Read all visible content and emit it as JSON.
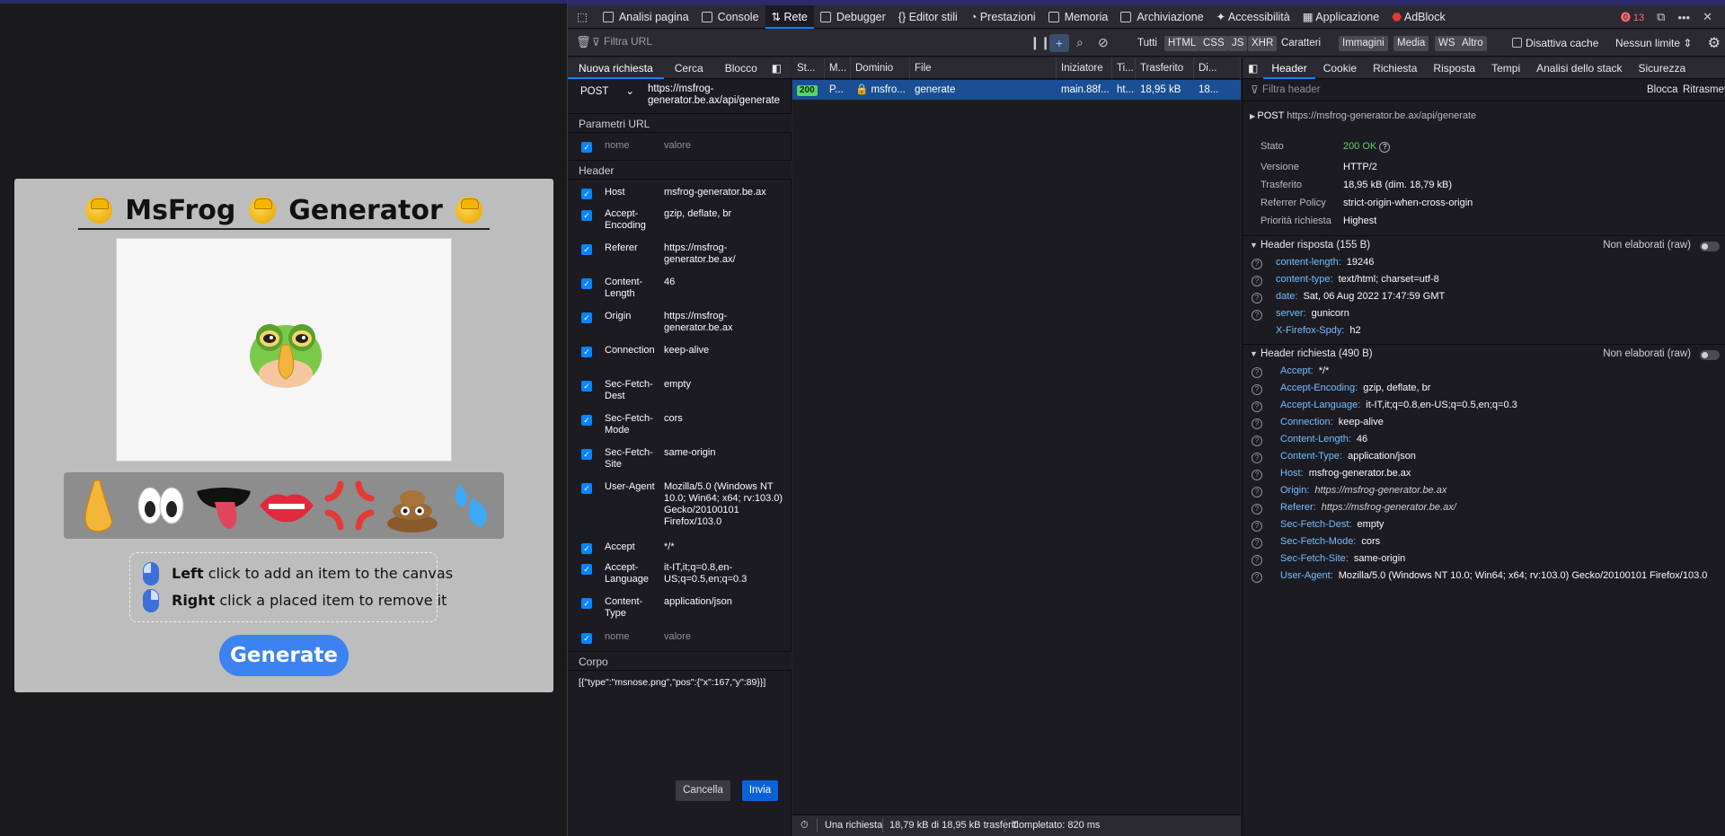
{
  "page": {
    "title_word_1": "MsFrog",
    "title_word_2": "Generator",
    "hint_left_bold": "Left",
    "hint_left_rest": " click to add an item to the canvas",
    "hint_right_bold": "Right",
    "hint_right_rest": " click a placed item to remove it",
    "generate_label": "Generate",
    "tools": [
      "nose",
      "eyes",
      "tongue",
      "lips",
      "anger",
      "poop",
      "sweat-drops"
    ]
  },
  "devtools": {
    "tabs": [
      "Analisi pagina",
      "Console",
      "Rete",
      "Debugger",
      "Editor stili",
      "Prestazioni",
      "Memoria",
      "Archiviazione",
      "Accessibilità",
      "Applicazione",
      "AdBlock"
    ],
    "active_tab": "Rete",
    "error_count": "13",
    "toolbar": {
      "filter_placeholder": "Filtra URL",
      "types": [
        "Tutti",
        "HTML",
        "CSS",
        "JS",
        "XHR",
        "Caratteri",
        "Immagini",
        "Media",
        "WS",
        "Altro"
      ],
      "disable_cache": "Disattiva cache",
      "throttle": "Nessun limite ⇕"
    },
    "composer": {
      "tabs": [
        "Nuova richiesta",
        "Cerca",
        "Blocco"
      ],
      "method": "POST",
      "url": "https://msfrog-generator.be.ax/api/generate",
      "url_params_title": "Parametri URL",
      "placeholder_name": "nome",
      "placeholder_value": "valore",
      "headers_title": "Header",
      "headers": [
        {
          "k": "Host",
          "v": "msfrog-generator.be.ax"
        },
        {
          "k": "Accept-Encoding",
          "v": "gzip, deflate, br"
        },
        {
          "k": "Referer",
          "v": "https://msfrog-generator.be.ax/"
        },
        {
          "k": "Content-Length",
          "v": "46"
        },
        {
          "k": "Origin",
          "v": "https://msfrog-generator.be.ax"
        },
        {
          "k": "Connection",
          "v": "keep-alive"
        },
        {
          "k": "Sec-Fetch-Dest",
          "v": "empty"
        },
        {
          "k": "Sec-Fetch-Mode",
          "v": "cors"
        },
        {
          "k": "Sec-Fetch-Site",
          "v": "same-origin"
        },
        {
          "k": "User-Agent",
          "v": "Mozilla/5.0 (Windows NT 10.0; Win64; x64; rv:103.0) Gecko/20100101 Firefox/103.0"
        },
        {
          "k": "Accept",
          "v": "*/*"
        },
        {
          "k": "Accept-Language",
          "v": "it-IT,it;q=0.8,en-US;q=0.5,en;q=0.3"
        },
        {
          "k": "Content-Type",
          "v": "application/json"
        }
      ],
      "body_title": "Corpo",
      "body": "[{\"type\":\"msnose.png\",\"pos\":{\"x\":167,\"y\":89}}]",
      "cancel": "Cancella",
      "send": "Invia"
    },
    "list": {
      "columns": [
        "St...",
        "M...",
        "Dominio",
        "File",
        "Iniziatore",
        "Ti...",
        "Trasferito",
        "Di..."
      ],
      "row": {
        "status": "200",
        "method": "P...",
        "domain": "msfro...",
        "file": "generate",
        "initiator": "main.88f...",
        "type": "ht...",
        "transferred": "18,95 kB",
        "size": "18..."
      },
      "status_summary": "Una richiesta",
      "transferred_summary": "18,79 kB di 18,95 kB trasferiti",
      "completed": "Completato: 820 ms"
    },
    "details": {
      "tabs": [
        "Header",
        "Cookie",
        "Richiesta",
        "Risposta",
        "Tempi",
        "Analisi dello stack",
        "Sicurezza"
      ],
      "filter_placeholder": "Filtra header",
      "block_label": "Blocca",
      "resend_label": "Ritrasmetti",
      "request_method": "POST",
      "request_url": "https://msfrog-generator.be.ax/api/generate",
      "summary": [
        {
          "k": "Stato",
          "v": "200 OK"
        },
        {
          "k": "Versione",
          "v": "HTTP/2"
        },
        {
          "k": "Trasferito",
          "v": "18,95 kB (dim. 18,79 kB)"
        },
        {
          "k": "Referrer Policy",
          "v": "strict-origin-when-cross-origin"
        },
        {
          "k": "Priorità richiesta",
          "v": "Highest"
        }
      ],
      "response_headers_title": "Header risposta (155 B)",
      "raw_label": "Non elaborati (raw)",
      "response_headers": [
        {
          "k": "content-length:",
          "v": "19246"
        },
        {
          "k": "content-type:",
          "v": "text/html; charset=utf-8"
        },
        {
          "k": "date:",
          "v": "Sat, 06 Aug 2022 17:47:59 GMT"
        },
        {
          "k": "server:",
          "v": "gunicorn"
        },
        {
          "k": "X-Firefox-Spdy:",
          "v": "h2"
        }
      ],
      "request_headers_title": "Header richiesta (490 B)",
      "request_headers": [
        {
          "k": "Accept:",
          "v": "*/*"
        },
        {
          "k": "Accept-Encoding:",
          "v": "gzip, deflate, br"
        },
        {
          "k": "Accept-Language:",
          "v": "it-IT,it;q=0.8,en-US;q=0.5,en;q=0.3"
        },
        {
          "k": "Connection:",
          "v": "keep-alive"
        },
        {
          "k": "Content-Length:",
          "v": "46"
        },
        {
          "k": "Content-Type:",
          "v": "application/json"
        },
        {
          "k": "Host:",
          "v": "msfrog-generator.be.ax"
        },
        {
          "k": "Origin:",
          "v": "https://msfrog-generator.be.ax"
        },
        {
          "k": "Referer:",
          "v": "https://msfrog-generator.be.ax/"
        },
        {
          "k": "Sec-Fetch-Dest:",
          "v": "empty"
        },
        {
          "k": "Sec-Fetch-Mode:",
          "v": "cors"
        },
        {
          "k": "Sec-Fetch-Site:",
          "v": "same-origin"
        },
        {
          "k": "User-Agent:",
          "v": "Mozilla/5.0 (Windows NT 10.0; Win64; x64; rv:103.0) Gecko/20100101 Firefox/103.0"
        }
      ]
    }
  }
}
